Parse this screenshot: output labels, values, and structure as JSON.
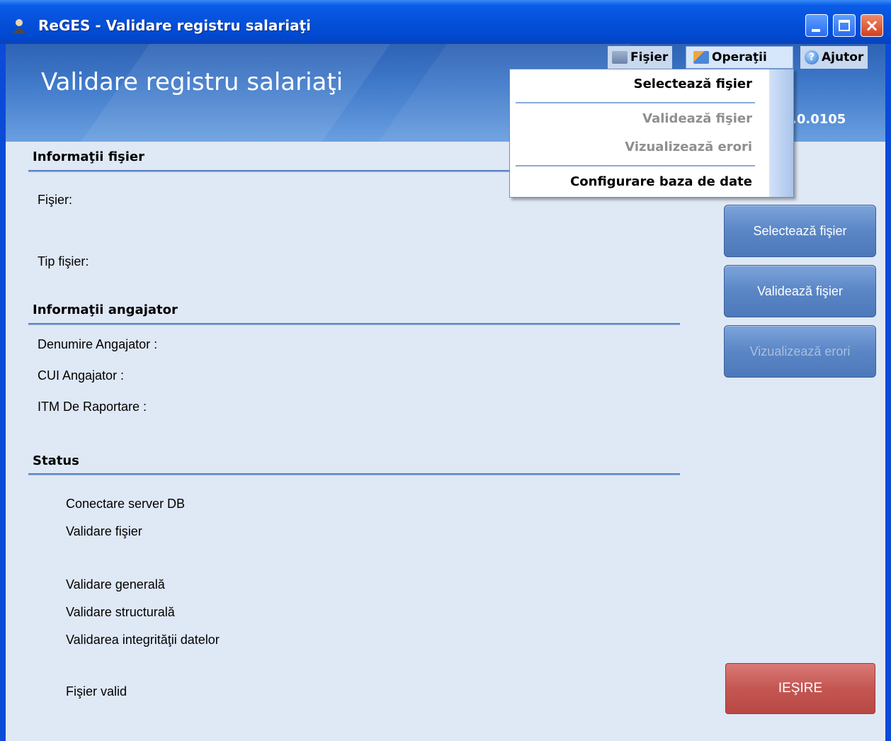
{
  "window": {
    "title": "ReGES -  Validare registru salariaţi",
    "controls": {
      "minimize": "minimize",
      "maximize": "maximize",
      "close": "×"
    }
  },
  "banner": {
    "title": "Validare registru salariaţi",
    "version": ".0.0105"
  },
  "menubar": {
    "items": [
      {
        "label": "Fişier",
        "icon": "folder-icon"
      },
      {
        "label": "Operaţii",
        "icon": "operations-icon",
        "open": true
      },
      {
        "label": "Ajutor",
        "icon": "help-icon"
      }
    ]
  },
  "dropdown": {
    "items": [
      {
        "label": "Selectează fişier",
        "enabled": true
      },
      {
        "label": "Validează fişier",
        "enabled": false
      },
      {
        "label": "Vizualizează erori",
        "enabled": false
      },
      {
        "label": "Configurare baza de date",
        "enabled": true
      }
    ]
  },
  "file_info": {
    "title": "Informaţii fişier",
    "file_label": "Fişier:",
    "type_label": "Tip fişier:"
  },
  "employer_info": {
    "title": "Informaţii angajator",
    "name_label": "Denumire Angajator :",
    "cui_label": "CUI Angajator :",
    "itm_label": "ITM De Raportare :"
  },
  "status": {
    "title": "Status",
    "items": [
      "Conectare server DB",
      "Validare fişier",
      "Validare generală",
      "Validare structurală",
      "Validarea integrităţii datelor",
      "Fişier valid"
    ]
  },
  "buttons": {
    "select": "Selectează fişier",
    "validate": "Validează fişier",
    "view_errors": "Vizualizează erori",
    "exit": "IEŞIRE"
  },
  "colors": {
    "titlebar": "#0550d9",
    "client_bg": "#dfe8f5",
    "banner": "#3f79c9",
    "button": "#5a86c6",
    "exit_button": "#c45652",
    "disabled_text": "#8f8f8f"
  }
}
